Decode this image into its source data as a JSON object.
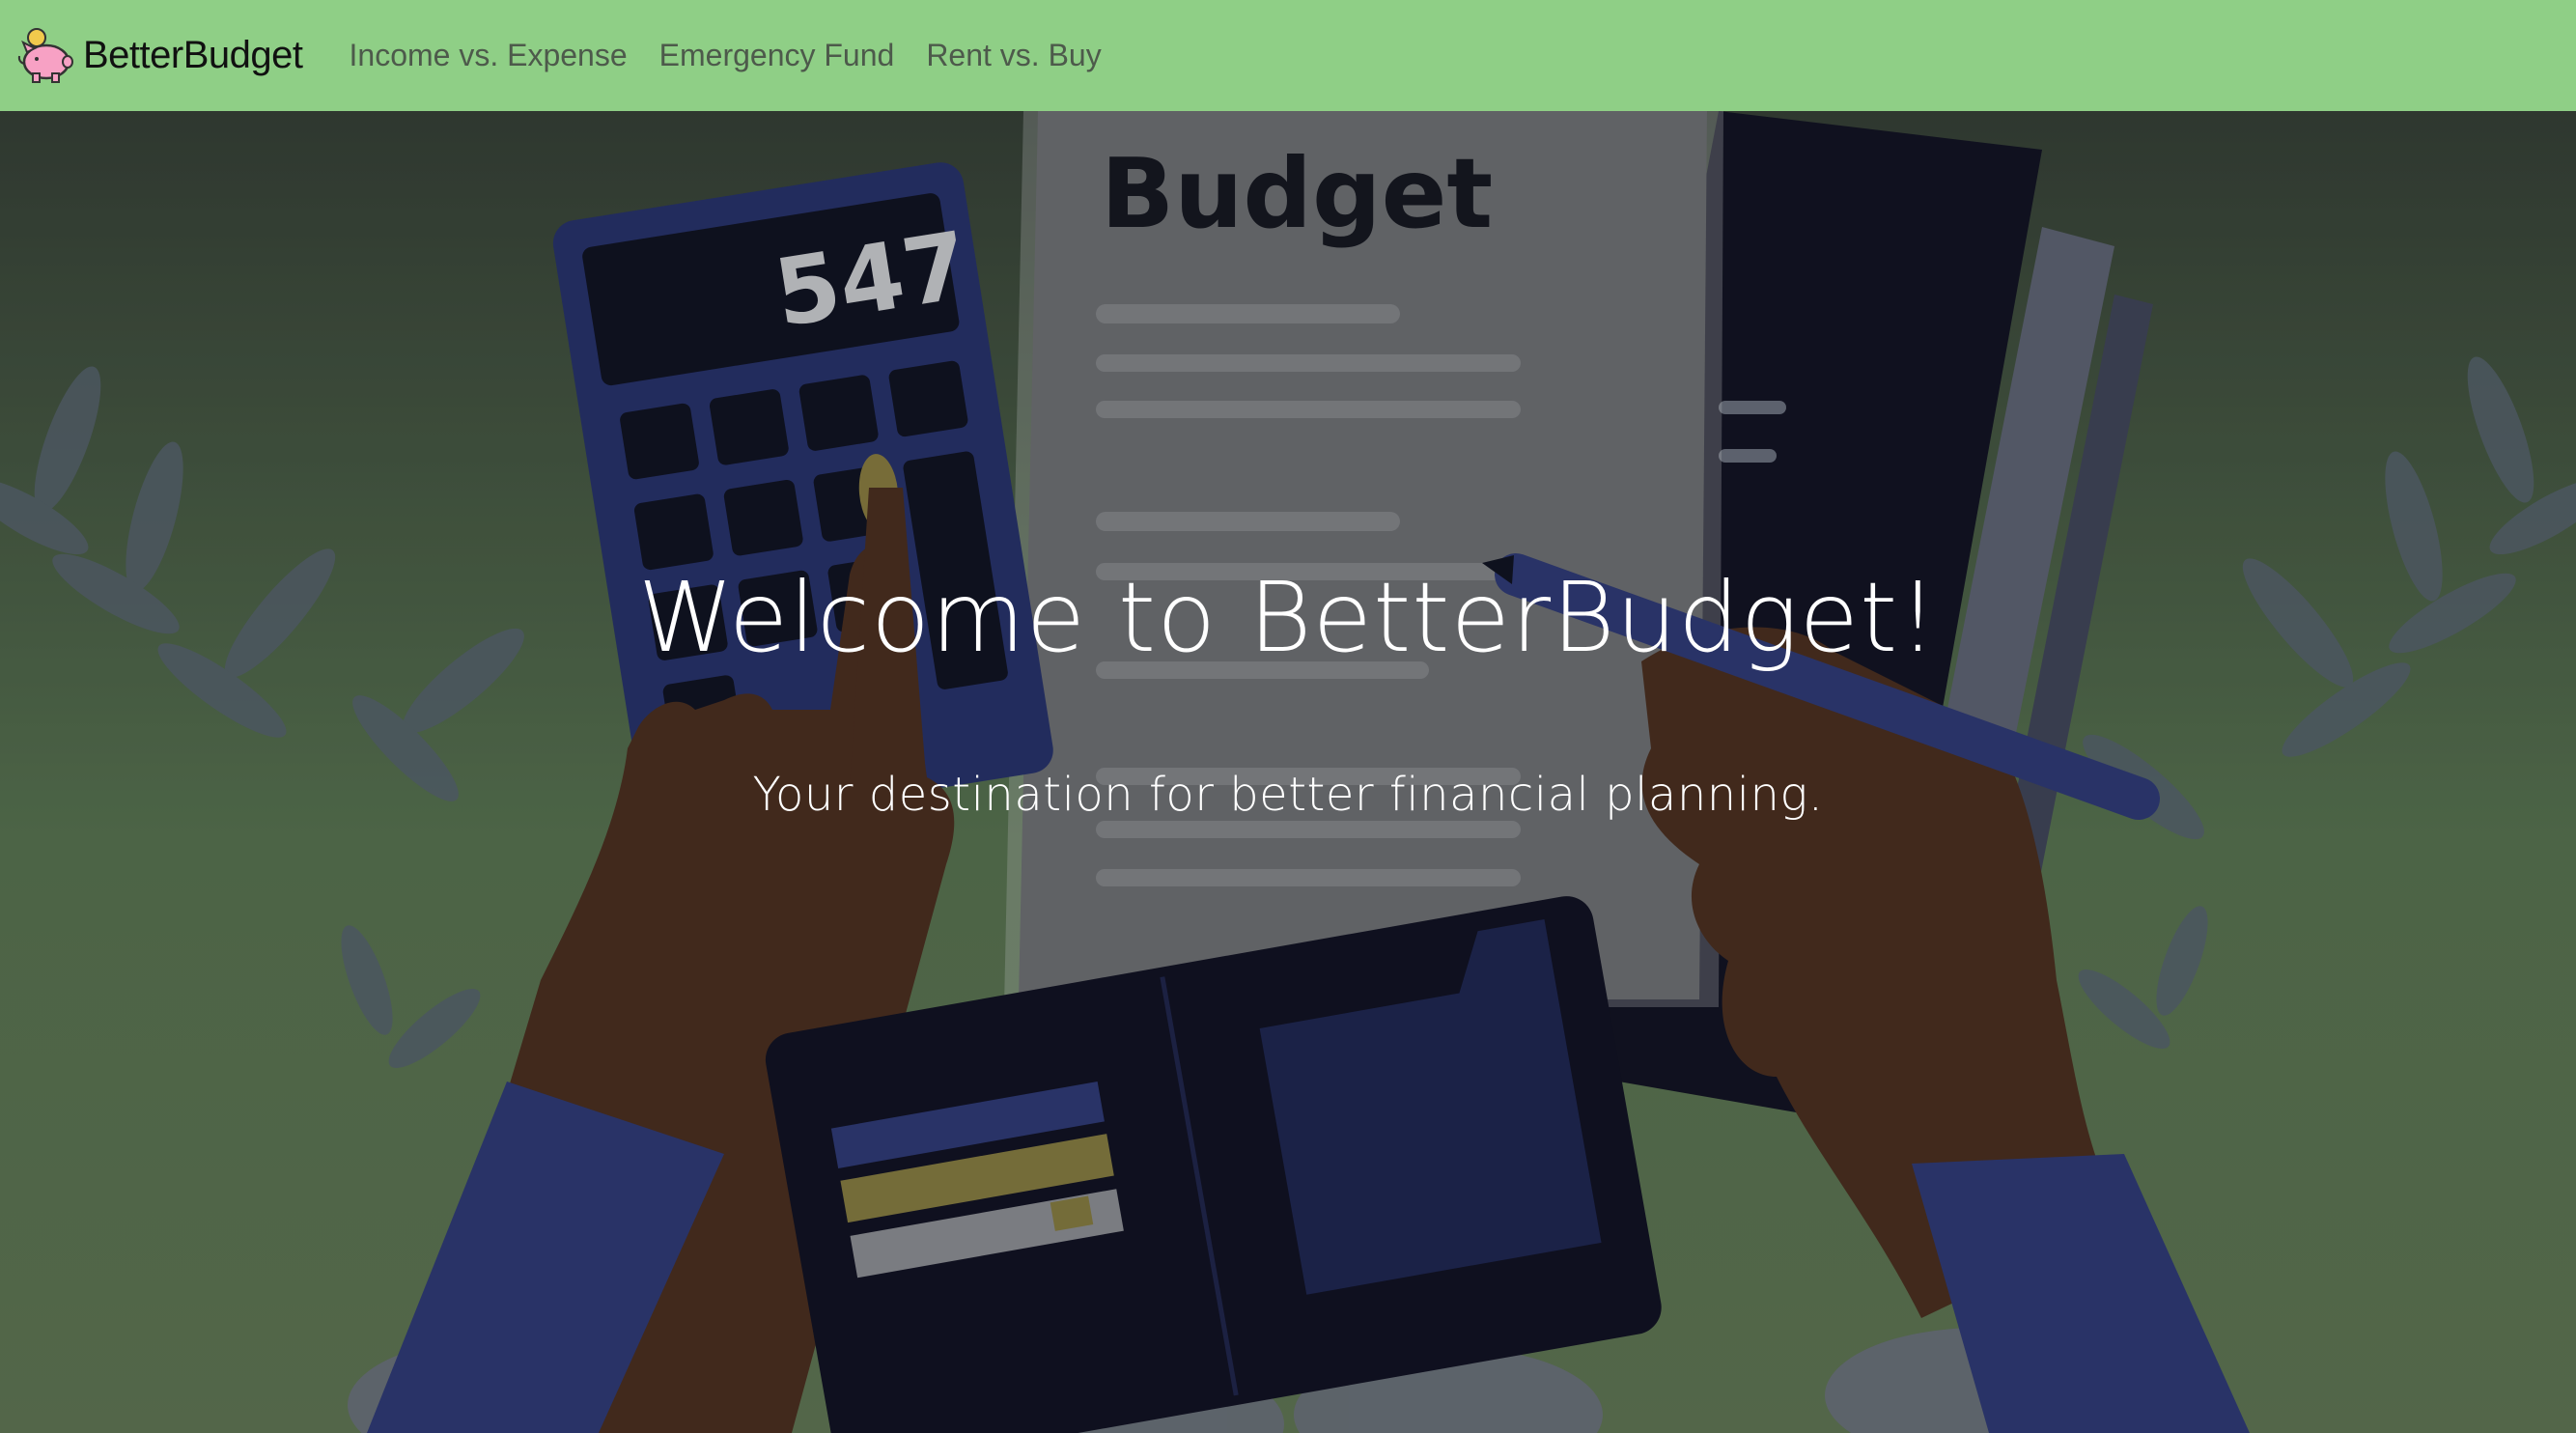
{
  "navbar": {
    "brand": {
      "name": "BetterBudget",
      "logo_icon": "piggy-bank-icon"
    },
    "links": [
      {
        "label": "Income vs. Expense"
      },
      {
        "label": "Emergency Fund"
      },
      {
        "label": "Rent vs. Buy"
      }
    ],
    "background_color": "#8fcf86"
  },
  "hero": {
    "title": "Welcome to BetterBudget!",
    "subtitle": "Your destination for better financial planning.",
    "illustration": {
      "description_icons": [
        "calculator-icon",
        "budget-document-icon",
        "wallet-icon",
        "pen-icon",
        "hands-icon"
      ],
      "calculator_display": "547",
      "document_heading": "Budget"
    },
    "overlay_color": "#2e3a30"
  }
}
